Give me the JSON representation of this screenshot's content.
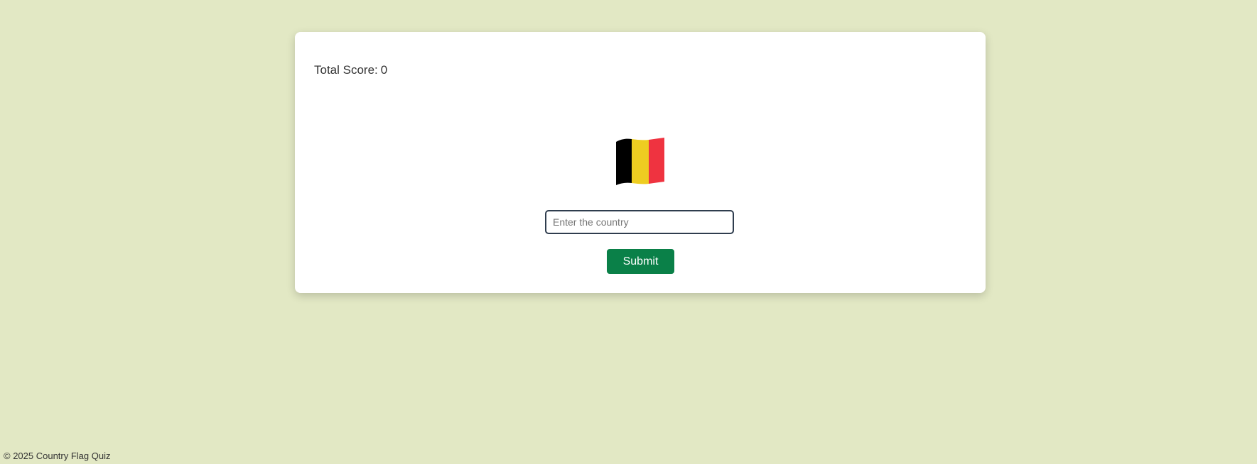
{
  "quiz": {
    "score_label": "Total Score:",
    "score_value": "0",
    "flag": {
      "icon": "belgium-flag-icon",
      "colors": [
        "#000000",
        "#fdda24",
        "#ef3340"
      ]
    },
    "input": {
      "placeholder": "Enter the country",
      "value": ""
    },
    "submit_label": "Submit"
  },
  "footer": {
    "text": "© 2025 Country Flag Quiz"
  },
  "colors": {
    "background": "#e2e8c4",
    "card": "#ffffff",
    "accent": "#0a8048"
  }
}
